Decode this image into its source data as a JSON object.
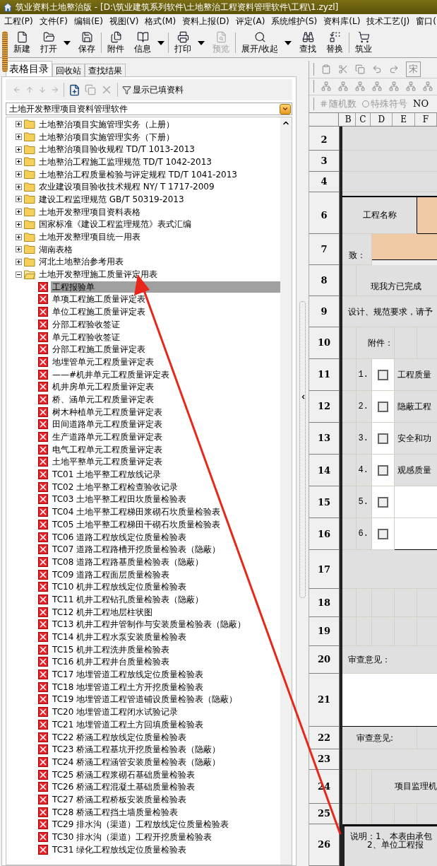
{
  "window": {
    "title": "筑业资料土地整治版 - [D:\\筑业建筑系列软件\\土地整治工程资料管理软件\\工程\\1.zyzl]"
  },
  "menu": [
    "工程(P)",
    "文件(F)",
    "编辑(E)",
    "视图(V)",
    "格式(M)",
    "资料上报(D)",
    "评定(A)",
    "系统维护(S)",
    "资料库(L)",
    "技术工艺(J)",
    "窗口("
  ],
  "toolbar": [
    {
      "kind": "new",
      "label": "新建",
      "disabled": false,
      "dropdown": false
    },
    {
      "kind": "open",
      "label": "打开",
      "disabled": false,
      "dropdown": true
    },
    {
      "kind": "save",
      "label": "保存",
      "disabled": false,
      "dropdown": false
    },
    {
      "kind": "attach",
      "label": "附件",
      "disabled": false,
      "dropdown": false
    },
    {
      "kind": "info",
      "label": "信息",
      "disabled": false,
      "dropdown": true
    },
    {
      "kind": "print",
      "label": "打印",
      "disabled": false,
      "dropdown": true
    },
    {
      "kind": "preview",
      "label": "预览",
      "disabled": true,
      "dropdown": false
    },
    {
      "kind": "expand",
      "label": "展开/收起",
      "disabled": false,
      "dropdown": true
    },
    {
      "kind": "find",
      "label": "查找",
      "disabled": false,
      "dropdown": false
    },
    {
      "kind": "replace",
      "label": "替换",
      "disabled": false,
      "dropdown": false
    },
    {
      "kind": "shop",
      "label": "筑业",
      "disabled": false,
      "dropdown": false
    }
  ],
  "left_panel": {
    "tabs": [
      {
        "label": "表格目录",
        "selected": true
      },
      {
        "label": "回收站",
        "selected": false
      },
      {
        "label": "查找结果",
        "selected": false
      }
    ],
    "show_filled_button": "显示已填资料",
    "software_select": {
      "value": "土地开发整理项目资料管理软件"
    },
    "tree": [
      {
        "label": "土地整治项目实施管理实务（上册）",
        "expanded": false
      },
      {
        "label": "土地整治项目实施管理实务（下册）",
        "expanded": false
      },
      {
        "label": "土地整治项目验收规程 TD/T 1013-2013",
        "expanded": false
      },
      {
        "label": "土地整治工程施工监理规范 TD/T 1042-2013",
        "expanded": false
      },
      {
        "label": "土地整治工程质量检验与评定规程 TD/T 1041-2013",
        "expanded": false
      },
      {
        "label": "农业建设项目验收技术规程 NY/ T 1717-2009",
        "expanded": false
      },
      {
        "label": "建设工程监理规范 GB/T 50319-2013",
        "expanded": false
      },
      {
        "label": "土地开发整理项目资料表格",
        "expanded": false
      },
      {
        "label": "国家标准《建设工程监理规范》表式汇编",
        "expanded": false
      },
      {
        "label": "土地开发整理项目统一用表",
        "expanded": false
      },
      {
        "label": "湖南表格",
        "expanded": false
      },
      {
        "label": "河北土地整治参考用表",
        "expanded": false
      },
      {
        "label": "土地开发整理施工质量评定用表",
        "expanded": true,
        "children": [
          {
            "label": "工程报验单",
            "selected": true
          },
          {
            "label": "单项工程施工质量评定表",
            "selected": false
          },
          {
            "label": "单位工程施工质量评定表",
            "selected": false
          },
          {
            "label": "分部工程验收签证",
            "selected": false
          },
          {
            "label": "单元工程验收签证",
            "selected": false
          },
          {
            "label": "分部工程施工质量评定表",
            "selected": false
          },
          {
            "label": "地埋管单元工程质量评定表",
            "selected": false
          },
          {
            "label": "——#机井单元工程质量评定表",
            "selected": false
          },
          {
            "label": "机井房单元工程质量评定表",
            "selected": false
          },
          {
            "label": "桥、涵单元工程质量评定表",
            "selected": false
          },
          {
            "label": "树木种植单元工程质量评定表",
            "selected": false
          },
          {
            "label": "田间道路单元工程质量评定表",
            "selected": false
          },
          {
            "label": "生产道路单元工程质量评定表",
            "selected": false
          },
          {
            "label": "电气工程单元工程质量评定表",
            "selected": false
          },
          {
            "label": "土地平整单元工程质量评定表",
            "selected": false
          },
          {
            "label": "TC01 土地平整工程放线记录",
            "selected": false
          },
          {
            "label": "TC02 土地平整工程检查验收记录",
            "selected": false
          },
          {
            "label": "TC03 土地平整工程田坎质量检验表",
            "selected": false
          },
          {
            "label": "TC04 土地平整工程梯田浆砌石坎质量检验表",
            "selected": false
          },
          {
            "label": "TC05 土地平整工程梯田干砌石坎质量检验表",
            "selected": false
          },
          {
            "label": "TC06 道路工程放线定位质量检验表",
            "selected": false
          },
          {
            "label": "TC07 道路工程路槽开挖质量检验表（隐蔽）",
            "selected": false
          },
          {
            "label": "TC08 道路工程路基质量检验表（隐蔽）",
            "selected": false
          },
          {
            "label": "TC09 道路工程面层质量检验表",
            "selected": false
          },
          {
            "label": "TC10 机井工程放线定位质量检验表",
            "selected": false
          },
          {
            "label": "TC11 机井工程钻孔质量检验表（隐蔽）",
            "selected": false
          },
          {
            "label": "TC12 机井工程地层柱状图",
            "selected": false
          },
          {
            "label": "TC13 机井工程井管制作与安装质量检验表（隐蔽）",
            "selected": false
          },
          {
            "label": "TC14 机井工程水泵安装质量检验表",
            "selected": false
          },
          {
            "label": "TC15 机井工程洗井质量检验表",
            "selected": false
          },
          {
            "label": "TC16 机井工程井台质量检验表",
            "selected": false
          },
          {
            "label": "TC17 地埋管道工程放线定位质量检验表",
            "selected": false
          },
          {
            "label": "TC18 地埋管道工程土方开挖质量检验表",
            "selected": false
          },
          {
            "label": "TC19 地埋管道工程管道铺设质量检验表（隐蔽）",
            "selected": false
          },
          {
            "label": "TC20 地埋管道工程闭水试验记录",
            "selected": false
          },
          {
            "label": "TC21 地埋管道工程土方回填质量检验表",
            "selected": false
          },
          {
            "label": "TC22 桥涵工程放线定位质量检验表",
            "selected": false
          },
          {
            "label": "TC23 桥涵工程基坑开挖质量检验表（隐蔽）",
            "selected": false
          },
          {
            "label": "TC24 桥涵工程涵管安装质量检验表（隐蔽）",
            "selected": false
          },
          {
            "label": "TC25 桥涵工程浆砌石基础质量检验表",
            "selected": false
          },
          {
            "label": "TC26 桥涵工程混凝土基础质量检验表",
            "selected": false
          },
          {
            "label": "TC27 桥涵工程桥板安装质量检验表",
            "selected": false
          },
          {
            "label": "TC28 桥涵工程挡土墙质量检验表",
            "selected": false
          },
          {
            "label": "TC29 排水沟（渠道）工程放线定位质量检验表",
            "selected": false
          },
          {
            "label": "TC30 排水沟（渠道）工程开挖质量检验表",
            "selected": false
          },
          {
            "label": "TC31 绿化工程放线定位质量检验表",
            "selected": false
          }
        ]
      }
    ]
  },
  "editor": {
    "font_box": "宋",
    "random_button": "随机数",
    "symbol_button": "特殊符号",
    "number_button": "NO",
    "columns": [
      "B",
      "C",
      "D",
      "E",
      "F"
    ],
    "rows": [
      {
        "number": "2",
        "kind": "blank"
      },
      {
        "number": "3",
        "kind": "blank"
      },
      {
        "number": "4",
        "kind": "blank"
      },
      {
        "number": "6",
        "kind": "name",
        "text": "工程名称"
      },
      {
        "number": "7",
        "kind": "to",
        "text": "致："
      },
      {
        "number": "8",
        "kind": "indent",
        "text": "现我方已完成"
      },
      {
        "number": "9",
        "kind": "full",
        "text": "设计、规范要求，请予"
      },
      {
        "number": "10",
        "kind": "attach_head",
        "text": "附件："
      },
      {
        "number": "11",
        "kind": "attach",
        "index": "1.",
        "checked": false,
        "text": "工程质量"
      },
      {
        "number": "12",
        "kind": "attach",
        "index": "2.",
        "checked": false,
        "text": "隐蔽工程"
      },
      {
        "number": "13",
        "kind": "attach",
        "index": "3.",
        "checked": false,
        "text": "安全和功"
      },
      {
        "number": "14",
        "kind": "attach",
        "index": "4.",
        "checked": false,
        "text": "观感质量"
      },
      {
        "number": "15",
        "kind": "attach",
        "index": "5.",
        "checked": false
      },
      {
        "number": "16",
        "kind": "attach",
        "index": "6.",
        "checked": false
      },
      {
        "number": "17",
        "kind": "blank"
      },
      {
        "number": "18",
        "kind": "grid"
      },
      {
        "number": "19",
        "kind": "grid"
      },
      {
        "number": "20",
        "kind": "full",
        "text": "审查意见："
      },
      {
        "number": "21",
        "kind": "white"
      },
      {
        "number": "22",
        "kind": "review",
        "text": "审查意见:"
      },
      {
        "number": "23",
        "kind": "blank"
      },
      {
        "number": "24",
        "kind": "sign",
        "text": "项目监理机"
      },
      {
        "number": "25",
        "kind": "grid"
      },
      {
        "number": "26",
        "kind": "note",
        "lines": [
          "说明：1、本表由承包",
          "2、单位工程报"
        ]
      }
    ]
  }
}
